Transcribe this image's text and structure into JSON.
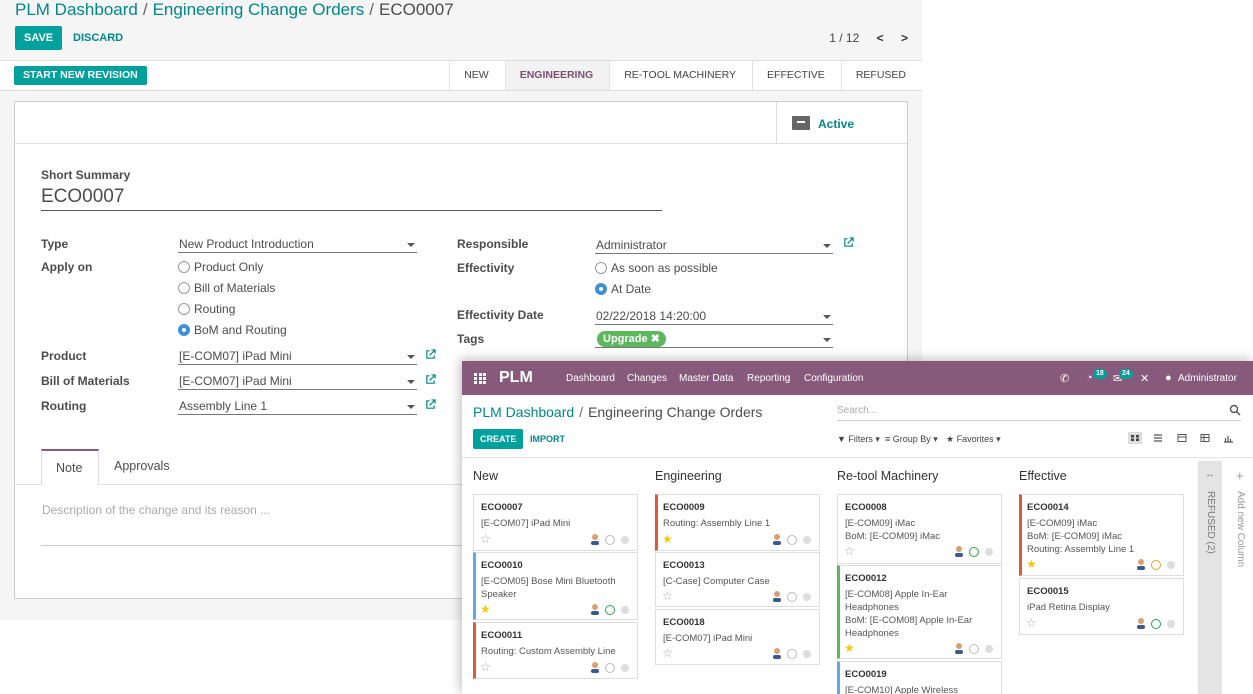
{
  "form": {
    "breadcrumb": {
      "root": "PLM Dashboard",
      "parent": "Engineering Change Orders",
      "current": "ECO0007"
    },
    "save_label": "SAVE",
    "discard_label": "DISCARD",
    "pager": "1 / 12",
    "start_revision_label": "START NEW REVISION",
    "stages": [
      {
        "label": "NEW",
        "active": false
      },
      {
        "label": "ENGINEERING",
        "active": true
      },
      {
        "label": "RE-TOOL MACHINERY",
        "active": false
      },
      {
        "label": "EFFECTIVE",
        "active": false
      },
      {
        "label": "REFUSED",
        "active": false
      }
    ],
    "active_label": "Active",
    "short_summary_label": "Short Summary",
    "short_summary_value": "ECO0007",
    "type_label": "Type",
    "type_value": "New Product Introduction",
    "apply_on_label": "Apply on",
    "apply_on_options": [
      {
        "label": "Product Only",
        "selected": false
      },
      {
        "label": "Bill of Materials",
        "selected": false
      },
      {
        "label": "Routing",
        "selected": false
      },
      {
        "label": "BoM and Routing",
        "selected": true
      }
    ],
    "product_label": "Product",
    "product_value": "[E-COM07] iPad Mini",
    "bom_label": "Bill of Materials",
    "bom_value": "[E-COM07] iPad Mini",
    "routing_label": "Routing",
    "routing_value": "Assembly Line 1",
    "responsible_label": "Responsible",
    "responsible_value": "Administrator",
    "effectivity_label": "Effectivity",
    "effectivity_options": [
      {
        "label": "As soon as possible",
        "selected": false
      },
      {
        "label": "At Date",
        "selected": true
      }
    ],
    "effectivity_date_label": "Effectivity Date",
    "effectivity_date_value": "02/22/2018 14:20:00",
    "tags_label": "Tags",
    "tag_value": "Upgrade ✖",
    "tabs": [
      "Note",
      "Approvals"
    ],
    "note_placeholder": "Description of the change and its reason ..."
  },
  "kanban": {
    "app_name": "PLM",
    "menu": [
      "Dashboard",
      "Changes",
      "Master Data",
      "Reporting",
      "Configuration"
    ],
    "badges": {
      "activities": "18",
      "messages": "24"
    },
    "user": "Administrator",
    "breadcrumb": {
      "root": "PLM Dashboard",
      "current": "Engineering Change Orders"
    },
    "search_placeholder": "Search...",
    "create_label": "CREATE",
    "import_label": "IMPORT",
    "filters_label": "▼ Filters ▾",
    "groupby_label": "≡ Group By ▾",
    "favorites_label": "★ Favorites ▾",
    "columns": [
      {
        "title": "New"
      },
      {
        "title": "Engineering"
      },
      {
        "title": "Re-tool Machinery"
      },
      {
        "title": "Effective"
      }
    ],
    "cards": {
      "c7": {
        "ref": "ECO0007",
        "line1": "[E-COM07] iPad Mini"
      },
      "c10": {
        "ref": "ECO0010",
        "line1": "[E-COM05] Bose Mini Bluetooth",
        "line2": "Speaker"
      },
      "c11": {
        "ref": "ECO0011",
        "line1": "Routing: Custom Assembly Line"
      },
      "c9": {
        "ref": "ECO0009",
        "line1": "Routing: Assembly Line 1"
      },
      "c13": {
        "ref": "ECO0013",
        "line1": "[C-Case] Computer Case"
      },
      "c18": {
        "ref": "ECO0018",
        "line1": "[E-COM07] iPad Mini"
      },
      "c8": {
        "ref": "ECO0008",
        "line1": "[E-COM09] iMac",
        "line2": "BoM: [E-COM09] iMac"
      },
      "c12": {
        "ref": "ECO0012",
        "line1": "[E-COM08] Apple In-Ear",
        "line2": "Headphones",
        "line3": "BoM: [E-COM08] Apple In-Ear",
        "line4": "Headphones"
      },
      "c19": {
        "ref": "ECO0019",
        "line1": "[E-COM10] Apple Wireless"
      },
      "c14": {
        "ref": "ECO0014",
        "line1": "[E-COM09] iMac",
        "line2": "BoM: [E-COM09] iMac",
        "line3": "Routing: Assembly Line 1"
      },
      "c15": {
        "ref": "ECO0015",
        "line1": "iPad Retina Display"
      }
    },
    "folded_column": "REFUSED (2)",
    "add_column": "Add new Column"
  }
}
